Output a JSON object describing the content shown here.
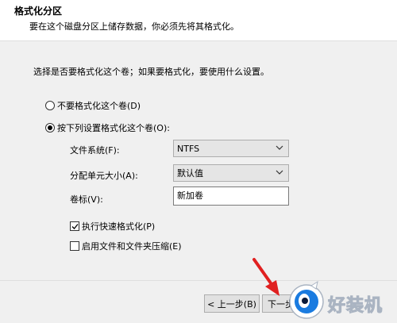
{
  "header": {
    "title": "格式化分区",
    "subtitle": "要在这个磁盘分区上储存数据，你必须先将其格式化。"
  },
  "prompt": "选择是否要格式化这个卷；如果要格式化，要使用什么设置。",
  "options": {
    "no_format": {
      "label": "不要格式化这个卷(D)",
      "selected": false
    },
    "format": {
      "label": "按下列设置格式化这个卷(O):",
      "selected": true
    }
  },
  "fields": {
    "filesystem": {
      "label": "文件系统(F):",
      "value": "NTFS"
    },
    "allocation": {
      "label": "分配单元大小(A):",
      "value": "默认值"
    },
    "volume_label": {
      "label": "卷标(V):",
      "value": "新加卷"
    }
  },
  "checks": {
    "quick_format": {
      "label": "执行快速格式化(P)",
      "checked": true
    },
    "compression": {
      "label": "启用文件和文件夹压缩(E)",
      "checked": false
    }
  },
  "buttons": {
    "back": "< 上一步(B)",
    "next": "下一步"
  },
  "watermark": {
    "text": "好装机"
  },
  "colors": {
    "arrow": "#e02020",
    "watermark_blue": "#1a7be0"
  }
}
